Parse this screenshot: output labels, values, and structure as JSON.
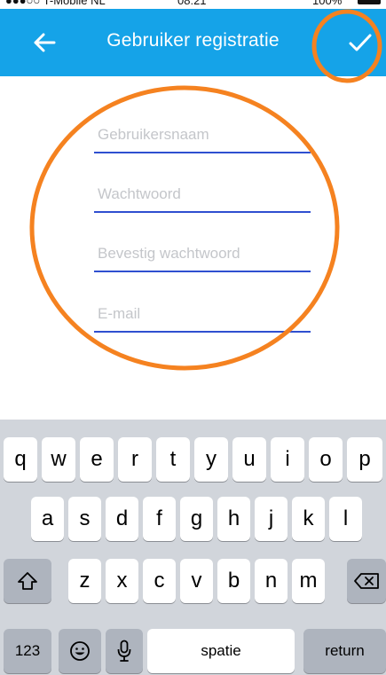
{
  "status_bar": {
    "carrier": "●●●○○ T-Mobile NL",
    "time": "08:21",
    "battery": "100%"
  },
  "nav": {
    "title": "Gebruiker registratie",
    "back_icon": "arrow-left-icon",
    "confirm_icon": "checkmark-icon"
  },
  "form": {
    "fields": [
      {
        "name": "username",
        "placeholder": "Gebruikersnaam",
        "value": ""
      },
      {
        "name": "password",
        "placeholder": "Wachtwoord",
        "value": ""
      },
      {
        "name": "confirm_password",
        "placeholder": "Bevestig wachtwoord",
        "value": ""
      },
      {
        "name": "email",
        "placeholder": "E-mail",
        "value": ""
      }
    ]
  },
  "keyboard": {
    "row1": [
      "q",
      "w",
      "e",
      "r",
      "t",
      "y",
      "u",
      "i",
      "o",
      "p"
    ],
    "row2": [
      "a",
      "s",
      "d",
      "f",
      "g",
      "h",
      "j",
      "k",
      "l"
    ],
    "row3": [
      "z",
      "x",
      "c",
      "v",
      "b",
      "n",
      "m"
    ],
    "numbers": "123",
    "space": "spatie",
    "return": "return",
    "shift_icon": "shift-icon",
    "backspace_icon": "backspace-icon",
    "emoji_icon": "emoji-icon",
    "mic_icon": "microphone-icon"
  },
  "colors": {
    "nav_bg": "#15a3e8",
    "underline": "#2f4fd0",
    "annotation": "#f58220",
    "keyboard_bg": "#d1d5db"
  }
}
